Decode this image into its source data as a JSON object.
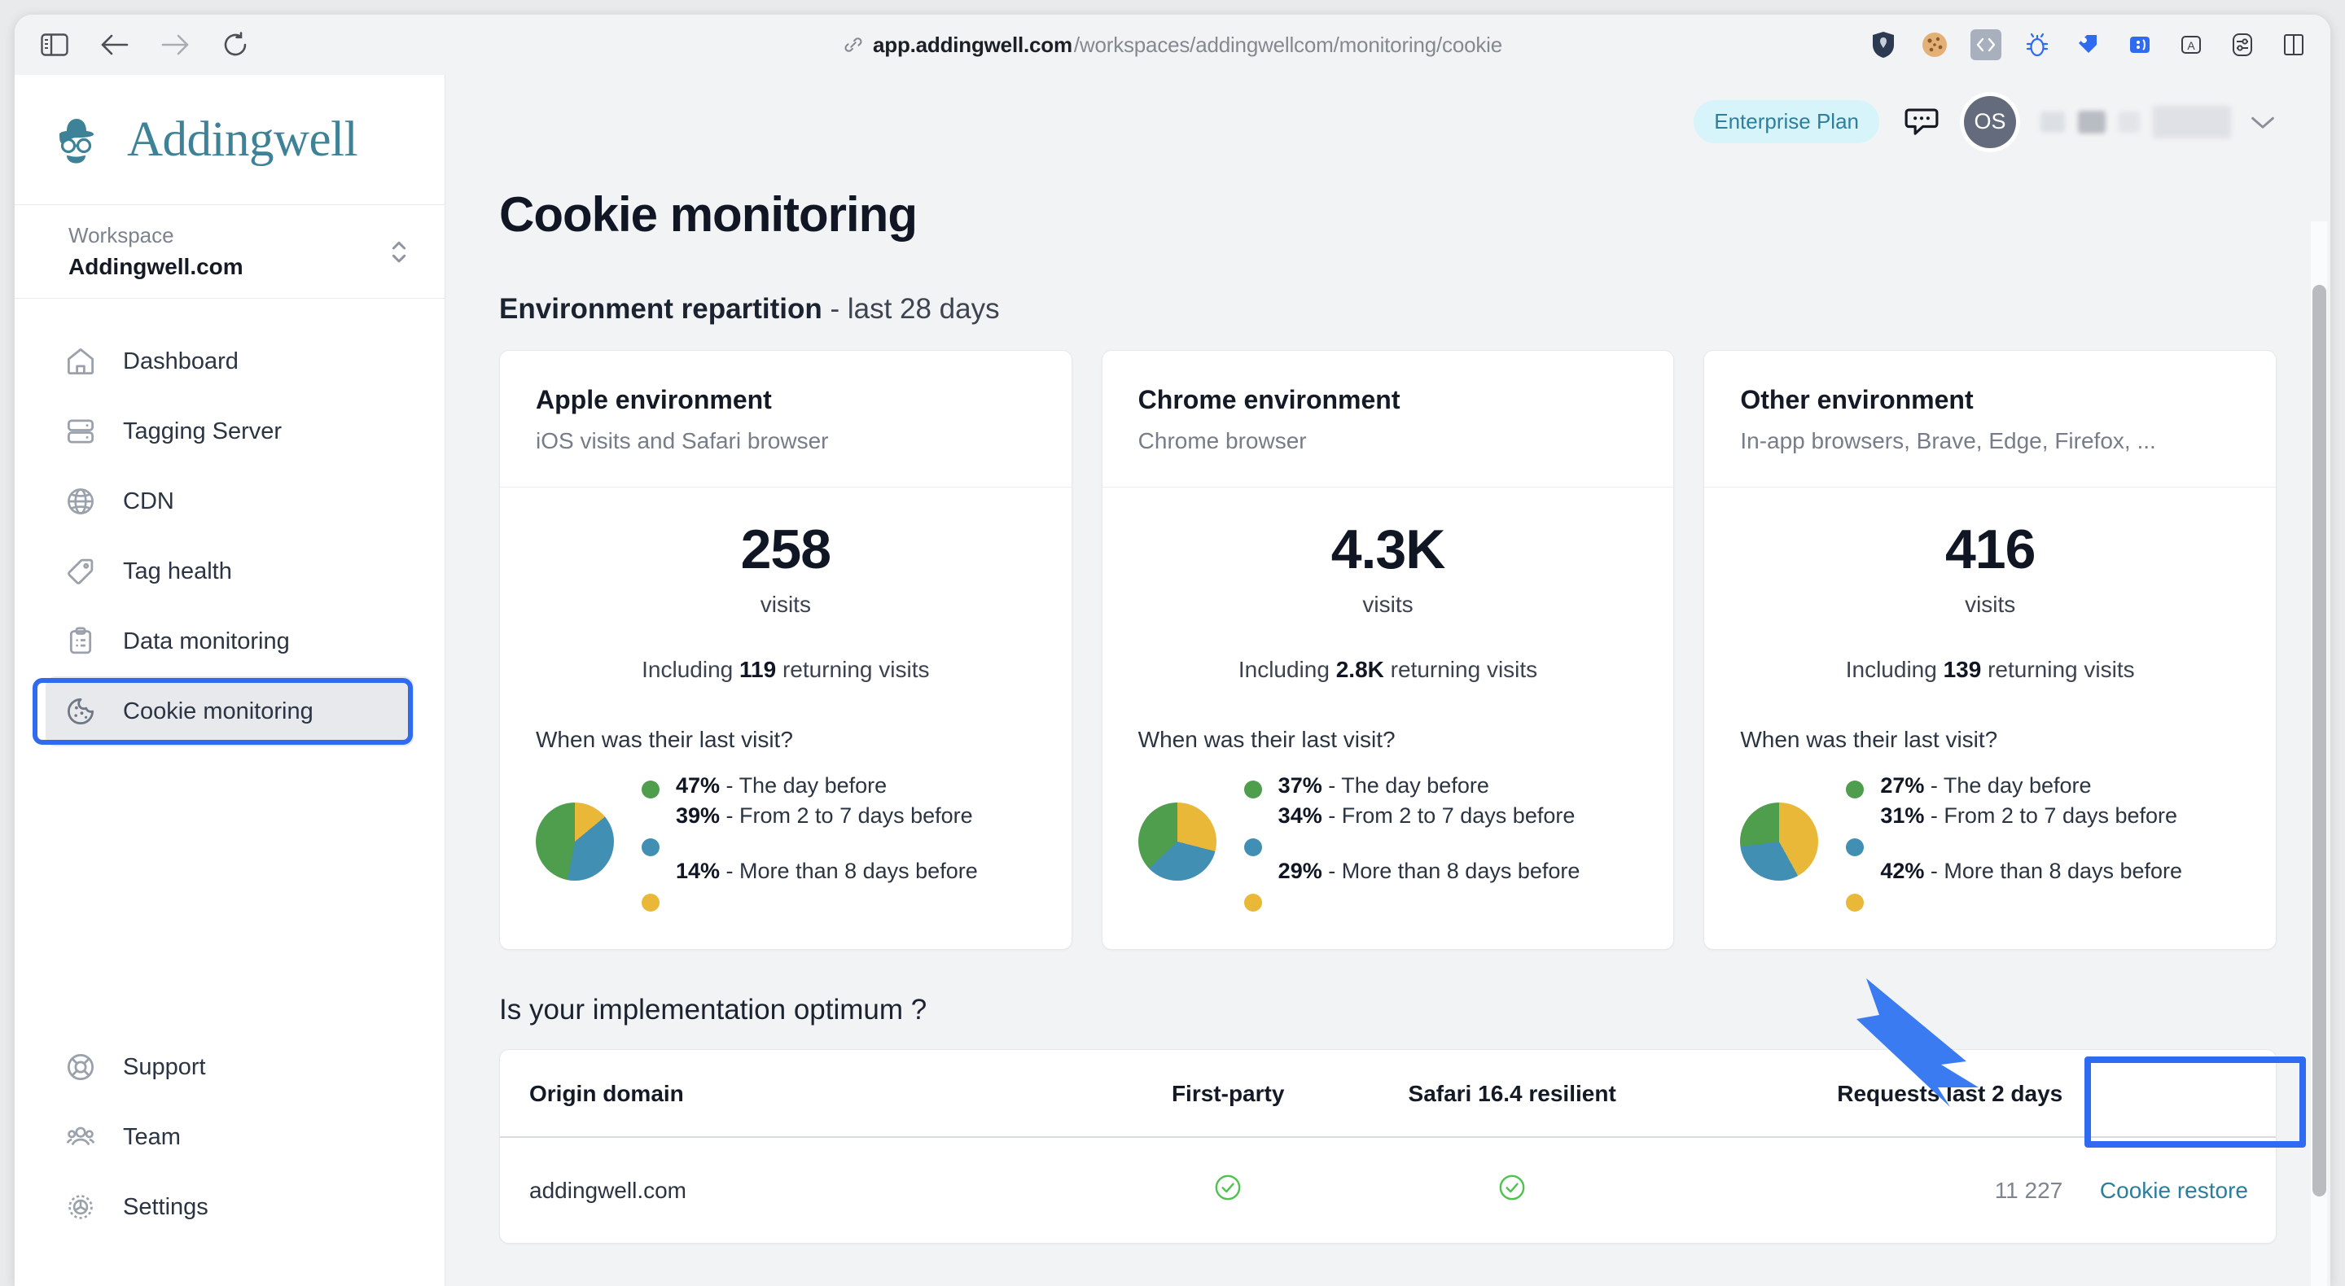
{
  "browser": {
    "toolbar_icons": [
      "sidebar-toggle-icon",
      "back-arrow-icon",
      "forward-arrow-icon",
      "reload-icon"
    ],
    "url_domain": "app.addingwell.com",
    "url_path": "/workspaces/addingwellcom/monitoring/cookie",
    "link_icon": "link-icon",
    "extensions": [
      "shield-extension-icon",
      "cookie-extension-icon",
      "code-extension-icon",
      "bug-extension-icon",
      "tag-extension-icon",
      "debugger-extension-icon",
      "text-extension-icon",
      "sliders-extension-icon",
      "split-view-icon"
    ]
  },
  "sidebar": {
    "brand_name": "Addingwell",
    "brand_logo": "bowler-hat-glasses-mustache-logo",
    "brand_color": "#3e8298",
    "workspace_label": "Workspace",
    "workspace_value": "Addingwell.com",
    "workspace_switch_icon": "chevron-up-down-icon",
    "items_top": [
      {
        "label": "Dashboard",
        "icon": "home-icon",
        "active": false
      },
      {
        "label": "Tagging Server",
        "icon": "server-icon",
        "active": false
      },
      {
        "label": "CDN",
        "icon": "globe-icon",
        "active": false
      },
      {
        "label": "Tag health",
        "icon": "tag-icon",
        "active": false
      },
      {
        "label": "Data monitoring",
        "icon": "clipboard-list-icon",
        "active": false
      },
      {
        "label": "Cookie monitoring",
        "icon": "cookie-icon",
        "active": true
      }
    ],
    "items_bottom": [
      {
        "label": "Support",
        "icon": "lifebuoy-icon"
      },
      {
        "label": "Team",
        "icon": "users-icon"
      },
      {
        "label": "Settings",
        "icon": "gear-icon"
      }
    ]
  },
  "topbar": {
    "plan_badge": "Enterprise Plan",
    "plan_badge_bg": "#d6f4f9",
    "plan_badge_color": "#2e7e9c",
    "chat_icon": "chat-bubble-icon",
    "avatar_initials": "OS",
    "account_chevron": "chevron-down-icon"
  },
  "page": {
    "title": "Cookie monitoring",
    "section1_title_bold": "Environment repartition",
    "section1_title_rest": " - last 28 days",
    "section2_title": "Is your implementation optimum ?"
  },
  "pie_colors": {
    "green": "#4f9e4d",
    "blue": "#4190b4",
    "yellow": "#e9b838"
  },
  "cards": [
    {
      "title": "Apple environment",
      "subtitle": "iOS visits and Safari browser",
      "value": "258",
      "value_label": "visits",
      "returning_prefix": "Including ",
      "returning_value": "119",
      "returning_suffix": " returning visits",
      "question": "When was their last visit?",
      "legend": [
        {
          "pct": "47%",
          "sep": " - ",
          "label": "The day before",
          "color": "#4f9e4d"
        },
        {
          "pct": "39%",
          "sep": " - ",
          "label": "From 2 to 7 days before",
          "color": "#4190b4"
        },
        {
          "pct": "14%",
          "sep": " - ",
          "label": "More than 8 days before",
          "color": "#e9b838"
        }
      ]
    },
    {
      "title": "Chrome environment",
      "subtitle": "Chrome browser",
      "value": "4.3K",
      "value_label": "visits",
      "returning_prefix": "Including ",
      "returning_value": "2.8K",
      "returning_suffix": " returning visits",
      "question": "When was their last visit?",
      "legend": [
        {
          "pct": "37%",
          "sep": " - ",
          "label": "The day before",
          "color": "#4f9e4d"
        },
        {
          "pct": "34%",
          "sep": " - ",
          "label": "From 2 to 7 days before",
          "color": "#4190b4"
        },
        {
          "pct": "29%",
          "sep": " - ",
          "label": "More than 8 days before",
          "color": "#e9b838"
        }
      ]
    },
    {
      "title": "Other environment",
      "subtitle": "In-app browsers, Brave, Edge, Firefox, ...",
      "value": "416",
      "value_label": "visits",
      "returning_prefix": "Including ",
      "returning_value": "139",
      "returning_suffix": " returning visits",
      "question": "When was their last visit?",
      "legend": [
        {
          "pct": "27%",
          "sep": " - ",
          "label": "The day before",
          "color": "#4f9e4d"
        },
        {
          "pct": "31%",
          "sep": " - ",
          "label": "From 2 to 7 days before",
          "color": "#4190b4"
        },
        {
          "pct": "42%",
          "sep": " - ",
          "label": "More than 8 days before",
          "color": "#e9b838"
        }
      ]
    }
  ],
  "table": {
    "columns": [
      "Origin domain",
      "First-party",
      "Safari 16.4 resilient",
      "Requests last 2 days",
      ""
    ],
    "row": {
      "origin_domain": "addingwell.com",
      "first_party": "check-circle-icon",
      "safari_resilient": "check-circle-icon",
      "requests": "11 227",
      "action_label": "Cookie restore"
    },
    "check_color": "#4fc24f"
  },
  "chart_data": [
    {
      "type": "pie",
      "title": "Apple environment - When was their last visit?",
      "categories": [
        "The day before",
        "From 2 to 7 days before",
        "More than 8 days before"
      ],
      "values": [
        47,
        39,
        14
      ],
      "unit": "%",
      "colors": [
        "#4f9e4d",
        "#4190b4",
        "#e9b838"
      ],
      "legend": "right",
      "total_visits": 258,
      "returning_visits": 119
    },
    {
      "type": "pie",
      "title": "Chrome environment - When was their last visit?",
      "categories": [
        "The day before",
        "From 2 to 7 days before",
        "More than 8 days before"
      ],
      "values": [
        37,
        34,
        29
      ],
      "unit": "%",
      "colors": [
        "#4f9e4d",
        "#4190b4",
        "#e9b838"
      ],
      "legend": "right",
      "total_visits": 4300,
      "returning_visits": 2800
    },
    {
      "type": "pie",
      "title": "Other environment - When was their last visit?",
      "categories": [
        "The day before",
        "From 2 to 7 days before",
        "More than 8 days before"
      ],
      "values": [
        27,
        31,
        42
      ],
      "unit": "%",
      "colors": [
        "#4f9e4d",
        "#4190b4",
        "#e9b838"
      ],
      "legend": "right",
      "total_visits": 416,
      "returning_visits": 139
    }
  ],
  "annotations": {
    "highlight_color": "#2f6bf0",
    "arrow": "blue-arrow-pointing-to-cookie-restore",
    "highlighted_elements": [
      "sidebar-item-cookie-monitoring",
      "cookie-restore-button"
    ]
  }
}
